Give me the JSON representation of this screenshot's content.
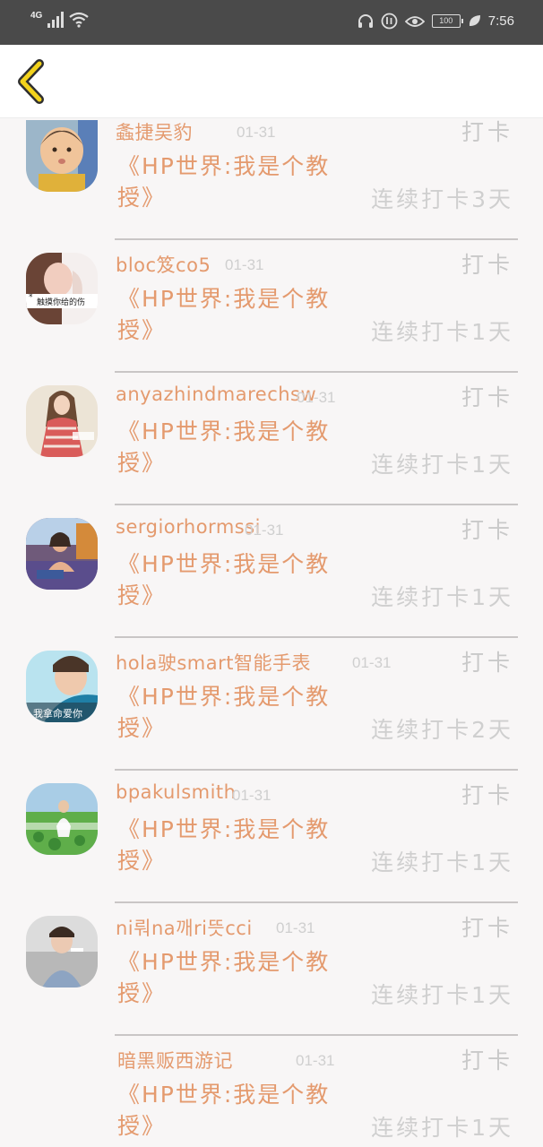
{
  "status_bar": {
    "network": "4G",
    "battery": "100",
    "time": "7:56"
  },
  "header": {
    "back_icon": "chevron-left-icon"
  },
  "checkins": [
    {
      "username": "螽捷吴豹",
      "date": "01-31",
      "action": "打卡",
      "book": "《HP世界:我是个教授》",
      "streak": "连续打卡3天"
    },
    {
      "username": "bloc笈co5",
      "date": "01-31",
      "action": "打卡",
      "book": "《HP世界:我是个教授》",
      "streak": "连续打卡1天",
      "avatar_caption": "触摸你给的伤"
    },
    {
      "username": "anyazhindmarechsw",
      "date": "01-31",
      "action": "打卡",
      "book": "《HP世界:我是个教授》",
      "streak": "连续打卡1天"
    },
    {
      "username": "sergiorhormssi",
      "date": "01-31",
      "action": "打卡",
      "book": "《HP世界:我是个教授》",
      "streak": "连续打卡1天"
    },
    {
      "username": "hola驶smart智能手表",
      "date": "01-31",
      "action": "打卡",
      "book": "《HP世界:我是个教授》",
      "streak": "连续打卡2天",
      "avatar_caption": "我拿命爱你"
    },
    {
      "username": "bpakulsmith",
      "date": "01-31",
      "action": "打卡",
      "book": "《HP世界:我是个教授》",
      "streak": "连续打卡1天"
    },
    {
      "username": "ni뤄na깨ri뜻cci",
      "date": "01-31",
      "action": "打卡",
      "book": "《HP世界:我是个教授》",
      "streak": "连续打卡1天"
    },
    {
      "username": "暗黑贩西游记",
      "date": "01-31",
      "action": "打卡",
      "book": "《HP世界:我是个教授》",
      "streak": "连续打卡1天"
    }
  ],
  "colors": {
    "accent": "#e49a6e",
    "muted": "#c9c9c9",
    "status_bar": "#4a4a4a",
    "back_icon": "#f2d21c"
  }
}
